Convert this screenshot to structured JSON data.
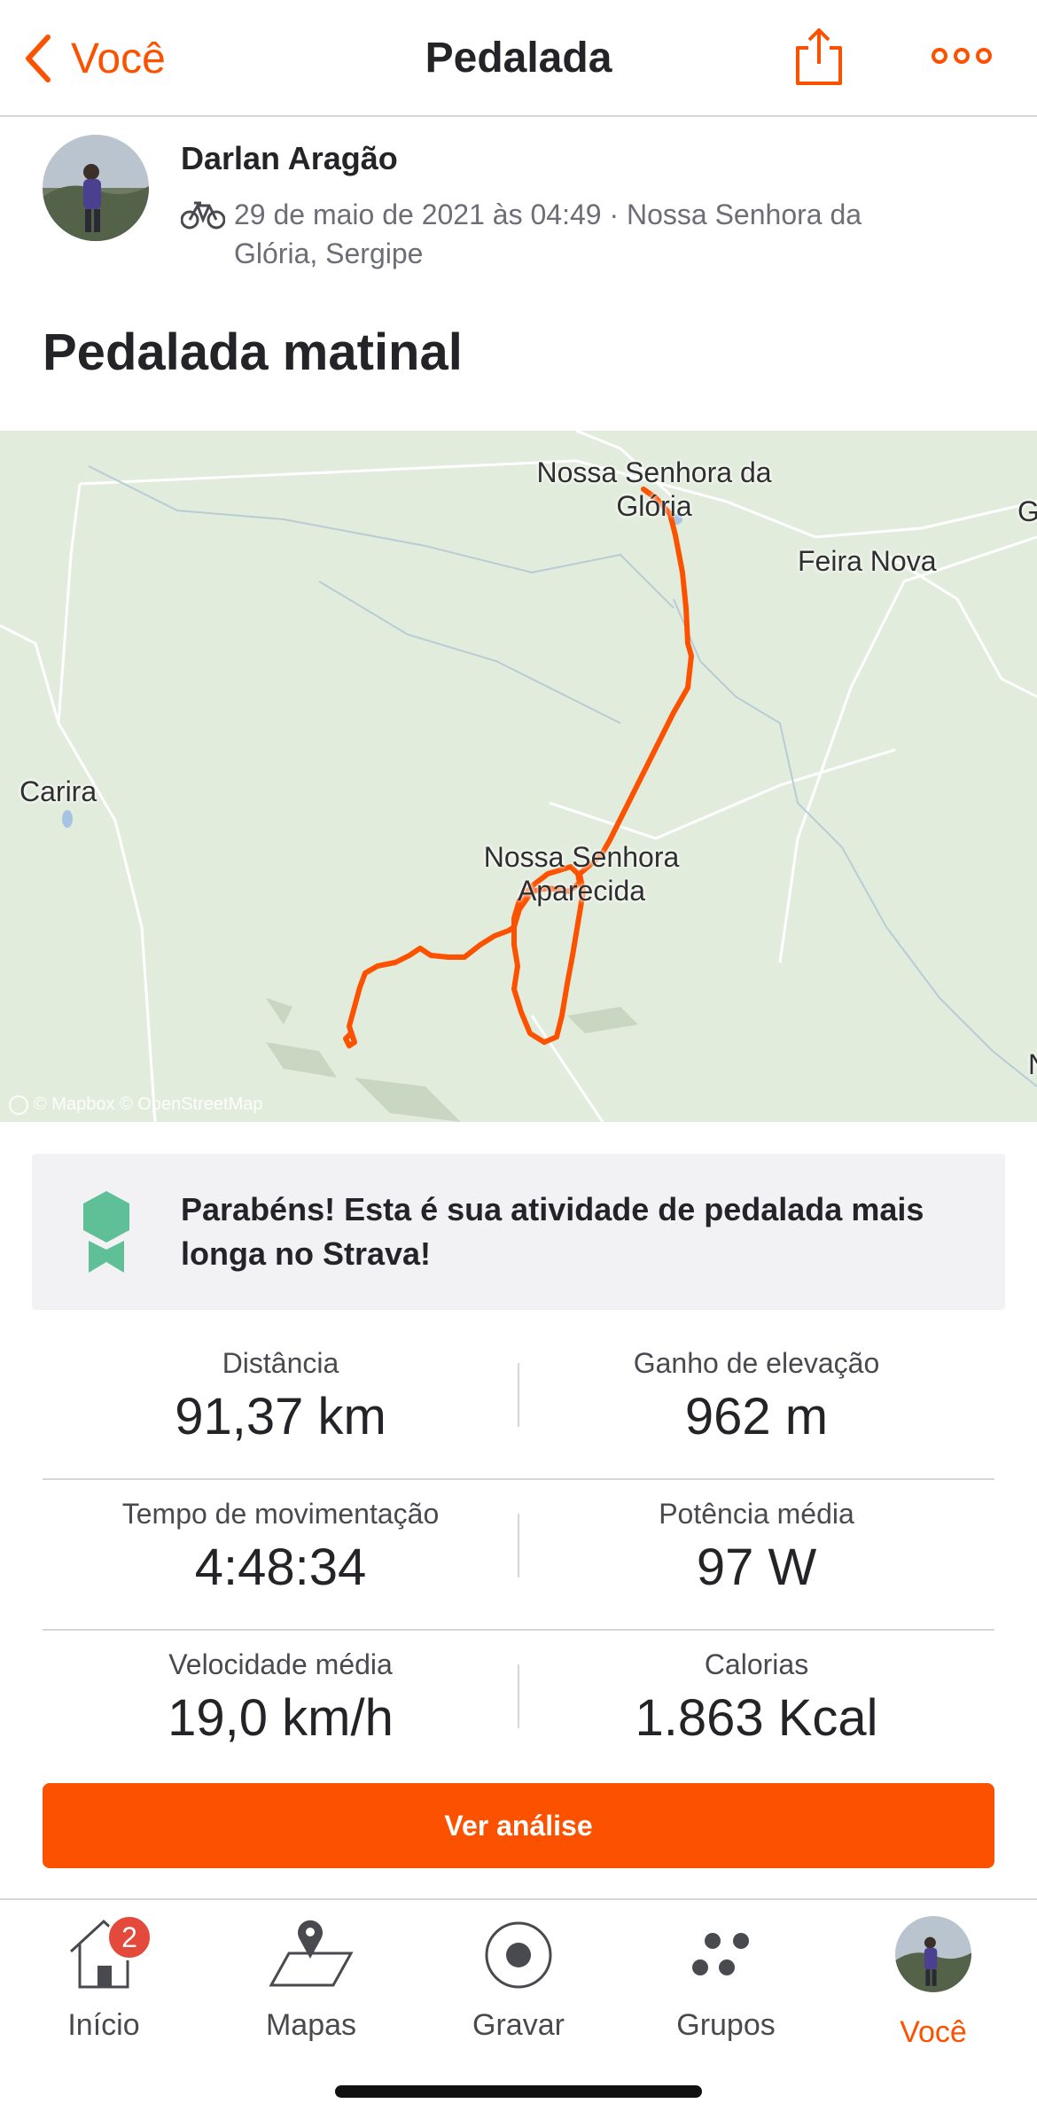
{
  "header": {
    "back_label": "Você",
    "title": "Pedalada",
    "share_icon": "share-icon",
    "more_icon": "more-icon"
  },
  "athlete": {
    "name": "Darlan Aragão",
    "activity_icon": "bike-icon",
    "meta": "29 de maio de 2021 às 04:49 · Nossa Senhora da Glória, Sergipe"
  },
  "activity": {
    "title": "Pedalada matinal"
  },
  "map": {
    "labels": {
      "glory": "Nossa Senhora da Glória",
      "feira": "Feira Nova",
      "carira": "Carira",
      "aparecida": "Nossa Senhora Aparecida",
      "edge_g": "G",
      "edge_n": "N"
    },
    "attribution": "© Mapbox © OpenStreetMap",
    "route_color": "#fc5200"
  },
  "achievement": {
    "text": "Parabéns! Esta é sua atividade de pedalada mais longa no Strava!",
    "medal_color": "#5fbf96"
  },
  "stats": [
    {
      "label": "Distância",
      "value": "91,37 km"
    },
    {
      "label": "Ganho de elevação",
      "value": "962 m"
    },
    {
      "label": "Tempo de movimentação",
      "value": "4:48:34"
    },
    {
      "label": "Potência média",
      "value": "97 W"
    },
    {
      "label": "Velocidade média",
      "value": "19,0 km/h"
    },
    {
      "label": "Calorias",
      "value": "1.863 Kcal"
    }
  ],
  "cta": {
    "label": "Ver análise"
  },
  "tabbar": {
    "home": {
      "label": "Início",
      "badge": "2"
    },
    "maps": {
      "label": "Mapas"
    },
    "record": {
      "label": "Gravar"
    },
    "groups": {
      "label": "Grupos"
    },
    "you": {
      "label": "Você"
    }
  },
  "colors": {
    "accent": "#fc5200",
    "map_bg": "#e2ecdd",
    "badge": "#e34a3b"
  }
}
